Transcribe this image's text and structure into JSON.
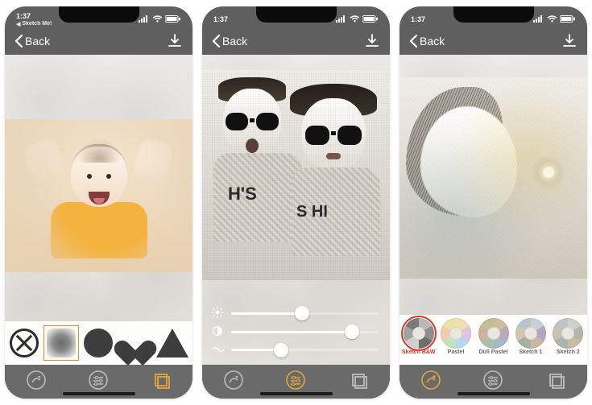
{
  "status": {
    "time": "1:37",
    "return_app": "Sketch Me!"
  },
  "nav": {
    "back": "Back"
  },
  "shapes": {
    "items": [
      "none",
      "square-blur",
      "circle",
      "heart",
      "triangle"
    ],
    "selected_index": 1
  },
  "sliders": {
    "brightness": 48,
    "contrast": 82,
    "wave": 34
  },
  "effects": {
    "selected_index": 0,
    "items": [
      {
        "label": "Sketch B&W",
        "wheel": [
          "#b9b9b9",
          "#8e8e8e",
          "#6e6e6e",
          "#cfcfcf",
          "#a2a2a2",
          "#7a7a7a"
        ]
      },
      {
        "label": "Pastel",
        "wheel": [
          "#f3dfae",
          "#e1c3e0",
          "#b7d6ef",
          "#c6e2bd",
          "#f6c9b1",
          "#e9e3a7"
        ]
      },
      {
        "label": "Dull Pastel",
        "wheel": [
          "#cbbf9e",
          "#bca9bd",
          "#a6b7c6",
          "#aebfa7",
          "#cdb2a0",
          "#c2bd96"
        ]
      },
      {
        "label": "Sketch 1",
        "wheel": [
          "#c8cfd6",
          "#b2a7c2",
          "#c9b7a1",
          "#a5b0a3",
          "#cfc6b2",
          "#b7c4cc"
        ]
      },
      {
        "label": "Sketch 2",
        "wheel": [
          "#d1cfca",
          "#b7b2aa",
          "#c7bba6",
          "#adb3ae",
          "#c9c1b4",
          "#bfc3c5"
        ]
      }
    ]
  },
  "toolbar": {
    "effects_tool": "effects",
    "adjust_tool": "adjust",
    "crop_tool": "crop"
  },
  "active_tool": {
    "p1": 2,
    "p2": 1,
    "p3": 0
  },
  "colors": {
    "accent": "#e3a637",
    "select": "#e88a2a",
    "alert": "#d3392b"
  }
}
